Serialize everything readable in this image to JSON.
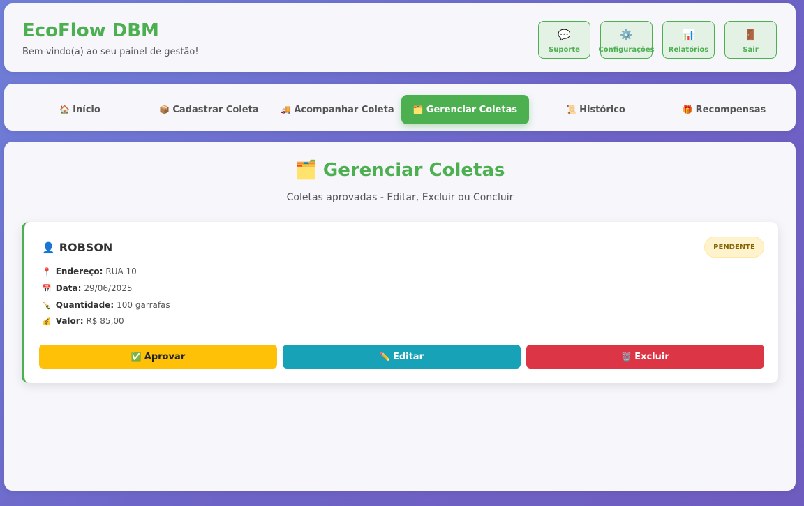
{
  "header": {
    "title": "EcoFlow DBM",
    "welcome": "Bem-vindo(a) ao seu painel de gestão!",
    "buttons": [
      {
        "icon": "💬",
        "label": "Suporte"
      },
      {
        "icon": "⚙️",
        "label": "Configurações"
      },
      {
        "icon": "📊",
        "label": "Relatórios"
      },
      {
        "icon": "🚪",
        "label": "Sair"
      }
    ]
  },
  "nav": {
    "tabs": [
      {
        "icon": "🏠",
        "label": "Início"
      },
      {
        "icon": "📦",
        "label": "Cadastrar Coleta"
      },
      {
        "icon": "🚚",
        "label": "Acompanhar Coleta"
      },
      {
        "icon": "🗂️",
        "label": "Gerenciar Coletas",
        "active": true
      },
      {
        "icon": "📜",
        "label": "Histórico"
      },
      {
        "icon": "🎁",
        "label": "Recompensas"
      }
    ]
  },
  "main": {
    "title_icon": "🗂️",
    "title": "Gerenciar Coletas",
    "subtitle": "Coletas aprovadas - Editar, Excluir ou Concluir",
    "collection": {
      "icon": "👤",
      "name": "ROBSON",
      "status": "PENDENTE",
      "details": [
        {
          "icon": "📍",
          "label": "Endereço:",
          "value": "RUA 10"
        },
        {
          "icon": "📅",
          "label": "Data:",
          "value": "29/06/2025"
        },
        {
          "icon": "🍾",
          "label": "Quantidade:",
          "value": "100 garrafas"
        },
        {
          "icon": "💰",
          "label": "Valor:",
          "value": "R$ 85,00"
        }
      ],
      "actions": [
        {
          "icon": "✅",
          "label": "Aprovar"
        },
        {
          "icon": "✏️",
          "label": "Editar"
        },
        {
          "icon": "🗑️",
          "label": "Excluir"
        }
      ]
    }
  },
  "colors": {
    "brand": "#4caf50",
    "approve": "#ffc107",
    "edit": "#17a2b8",
    "delete": "#dc3545",
    "badge_bg": "#fff3cd",
    "badge_text": "#856404"
  }
}
